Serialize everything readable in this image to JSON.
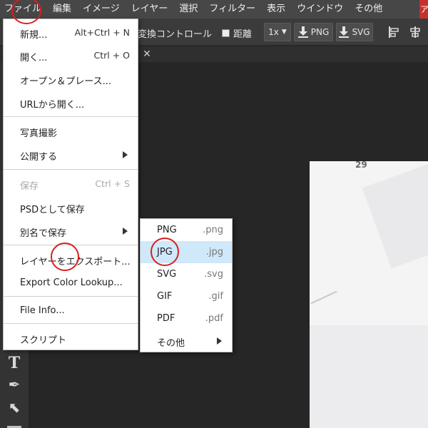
{
  "menubar": {
    "items": [
      "ファイル",
      "編集",
      "イメージ",
      "レイヤー",
      "選択",
      "フィルター",
      "表示",
      "ウインドウ",
      "その他"
    ],
    "account_label": "ア",
    "account_color": "#c5322c"
  },
  "toolbar": {
    "transform_text": "変換コントロール",
    "distance_label": "距離",
    "scale_value": "1x",
    "png_label": "PNG",
    "svg_label": "SVG"
  },
  "tabs": {
    "close_glyph": "✕"
  },
  "tools": {
    "type_glyph": "T",
    "pen_glyph": "✒",
    "select_glyph": "⬉"
  },
  "canvas": {
    "doc_number": "29"
  },
  "file_menu": {
    "items": [
      {
        "label": "新規...",
        "shortcut": "Alt+Ctrl + N"
      },
      {
        "label": "開く...",
        "shortcut": "Ctrl + O"
      },
      {
        "label": "オープン＆プレース..."
      },
      {
        "label": "URLから開く..."
      },
      {
        "label": "写真撮影"
      },
      {
        "label": "公開する"
      },
      {
        "label": "保存",
        "shortcut": "Ctrl + S",
        "disabled": true
      },
      {
        "label": "PSDとして保存"
      },
      {
        "label": "別名で保存"
      },
      {
        "label": "レイヤーをエクスポート..."
      },
      {
        "label": "Export Color Lookup..."
      },
      {
        "label": "File Info..."
      },
      {
        "label": "スクリプト"
      }
    ]
  },
  "save_as_submenu": {
    "items": [
      {
        "label": "PNG",
        "ext": ".png"
      },
      {
        "label": "JPG",
        "ext": ".jpg",
        "active": true
      },
      {
        "label": "SVG",
        "ext": ".svg"
      },
      {
        "label": "GIF",
        "ext": ".gif"
      },
      {
        "label": "PDF",
        "ext": ".pdf"
      },
      {
        "label": "その他"
      }
    ]
  },
  "colors": {
    "annotation_red": "#d81f1f",
    "highlight_blue": "#cfe8fa",
    "menubar_bg": "#474747"
  }
}
